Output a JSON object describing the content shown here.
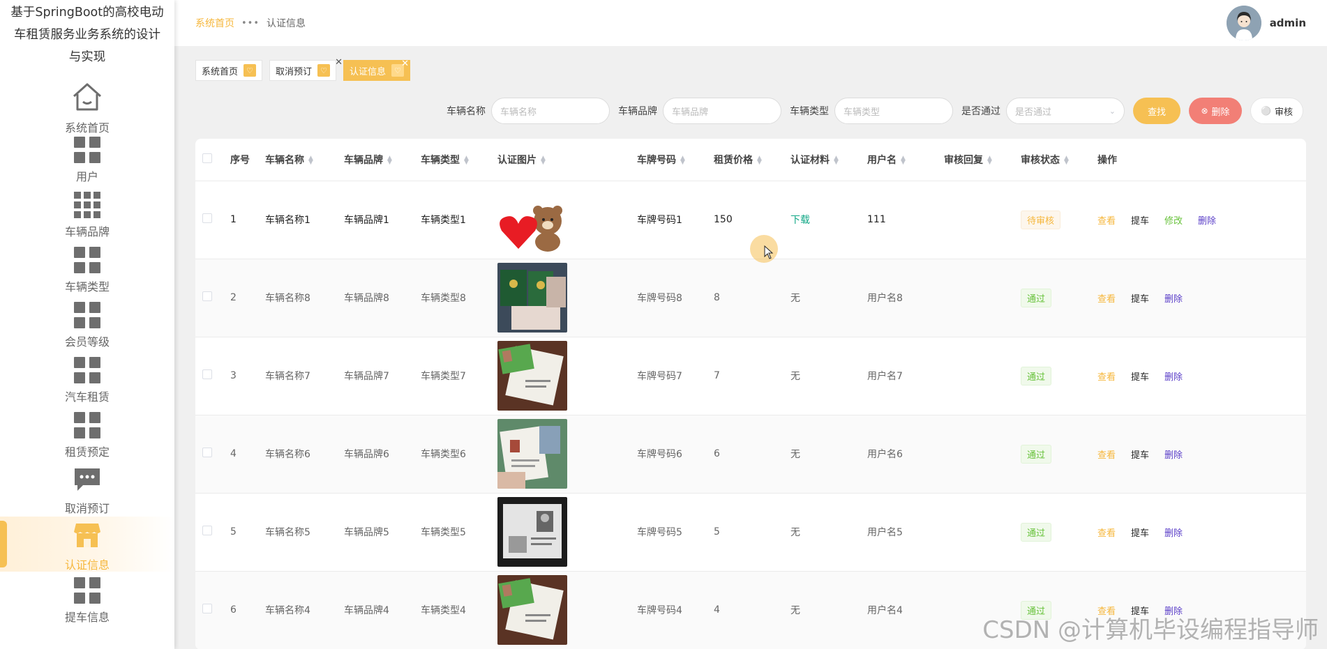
{
  "app": {
    "title": "基于SpringBoot的高校电动车租赁服务业务系统的设计与实现"
  },
  "sidebar": {
    "items": [
      {
        "label": "系统首页",
        "icon": "home-icon"
      },
      {
        "label": "用户",
        "icon": "grid-icon"
      },
      {
        "label": "车辆品牌",
        "icon": "grid9-icon"
      },
      {
        "label": "车辆类型",
        "icon": "grid-icon"
      },
      {
        "label": "会员等级",
        "icon": "grid-icon"
      },
      {
        "label": "汽车租赁",
        "icon": "grid-icon"
      },
      {
        "label": "租赁预定",
        "icon": "grid-icon"
      },
      {
        "label": "取消预订",
        "icon": "chat-icon"
      },
      {
        "label": "认证信息",
        "icon": "shop-icon",
        "active": true
      },
      {
        "label": "提车信息",
        "icon": "grid-icon"
      }
    ]
  },
  "header": {
    "breadcrumb_home": "系统首页",
    "breadcrumb_sep": "•••",
    "breadcrumb_current": "认证信息",
    "user_name": "admin"
  },
  "tags": [
    {
      "label": "系统首页",
      "active": false
    },
    {
      "label": "取消预订",
      "active": false
    },
    {
      "label": "认证信息",
      "active": true
    }
  ],
  "search": {
    "name_label": "车辆名称",
    "name_placeholder": "车辆名称",
    "brand_label": "车辆品牌",
    "brand_placeholder": "车辆品牌",
    "type_label": "车辆类型",
    "type_placeholder": "车辆类型",
    "pass_label": "是否通过",
    "pass_placeholder": "是否通过",
    "find_label": "查找",
    "delete_label": "删除",
    "audit_label": "审核"
  },
  "table": {
    "columns": [
      "序号",
      "车辆名称",
      "车辆品牌",
      "车辆类型",
      "认证图片",
      "车牌号码",
      "租赁价格",
      "认证材料",
      "用户名",
      "审核回复",
      "审核状态",
      "操作"
    ],
    "rows": [
      {
        "idx": "1",
        "name": "车辆名称1",
        "brand": "车辆品牌1",
        "type": "车辆类型1",
        "image": "bear-heart",
        "plate": "车牌号码1",
        "price": "150",
        "material": "下载",
        "user": "111",
        "reply": "",
        "status": "待审核",
        "ops": [
          "查看",
          "提车",
          "修改",
          "删除"
        ]
      },
      {
        "idx": "2",
        "name": "车辆名称8",
        "brand": "车辆品牌8",
        "type": "车辆类型8",
        "image": "green-certs",
        "plate": "车牌号码8",
        "price": "8",
        "material": "无",
        "user": "用户名8",
        "reply": "",
        "status": "通过",
        "ops": [
          "查看",
          "提车",
          "删除"
        ]
      },
      {
        "idx": "3",
        "name": "车辆名称7",
        "brand": "车辆品牌7",
        "type": "车辆类型7",
        "image": "card-brown",
        "plate": "车牌号码7",
        "price": "7",
        "material": "无",
        "user": "用户名7",
        "reply": "",
        "status": "通过",
        "ops": [
          "查看",
          "提车",
          "删除"
        ]
      },
      {
        "idx": "4",
        "name": "车辆名称6",
        "brand": "车辆品牌6",
        "type": "车辆类型6",
        "image": "booklet",
        "plate": "车牌号码6",
        "price": "6",
        "material": "无",
        "user": "用户名6",
        "reply": "",
        "status": "通过",
        "ops": [
          "查看",
          "提车",
          "删除"
        ]
      },
      {
        "idx": "5",
        "name": "车辆名称5",
        "brand": "车辆品牌5",
        "type": "车辆类型5",
        "image": "bw-card",
        "plate": "车牌号码5",
        "price": "5",
        "material": "无",
        "user": "用户名5",
        "reply": "",
        "status": "通过",
        "ops": [
          "查看",
          "提车",
          "删除"
        ]
      },
      {
        "idx": "6",
        "name": "车辆名称4",
        "brand": "车辆品牌4",
        "type": "车辆类型4",
        "image": "card-brown",
        "plate": "车牌号码4",
        "price": "4",
        "material": "无",
        "user": "用户名4",
        "reply": "",
        "status": "通过",
        "ops": [
          "查看",
          "提车",
          "删除"
        ]
      }
    ]
  },
  "watermark": "CSDN @计算机毕设编程指导师",
  "colors": {
    "accent": "#f6c053",
    "danger": "#f27f76",
    "success": "#67c23a",
    "link_purple": "#5b3fc8"
  }
}
